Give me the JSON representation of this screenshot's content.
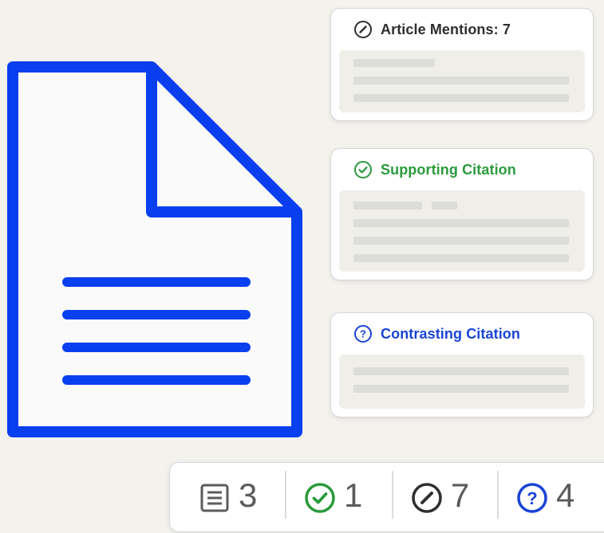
{
  "cards": {
    "mentions": {
      "title": "Article Mentions: 7",
      "icon": "pencil-circle-icon",
      "color": "#2e2e2e"
    },
    "supporting": {
      "title": "Supporting Citation",
      "icon": "check-circle-icon",
      "color": "#2a9a3c"
    },
    "contrasting": {
      "title": "Contrasting Citation",
      "icon": "question-circle-icon",
      "color": "#1a44d6"
    }
  },
  "stats": {
    "documents": {
      "count": "3",
      "icon": "document-lines-icon"
    },
    "supporting": {
      "count": "1",
      "icon": "check-circle-icon"
    },
    "mentions": {
      "count": "7",
      "icon": "pencil-circle-icon"
    },
    "contrasting": {
      "count": "4",
      "icon": "question-circle-icon"
    }
  },
  "colors": {
    "accent_blue": "#0a3ff0",
    "supporting_green": "#2a9a3c",
    "contrasting_blue": "#1a44d6",
    "placeholder_bar": "#dcdcd8",
    "background": "#f4f2ed"
  }
}
